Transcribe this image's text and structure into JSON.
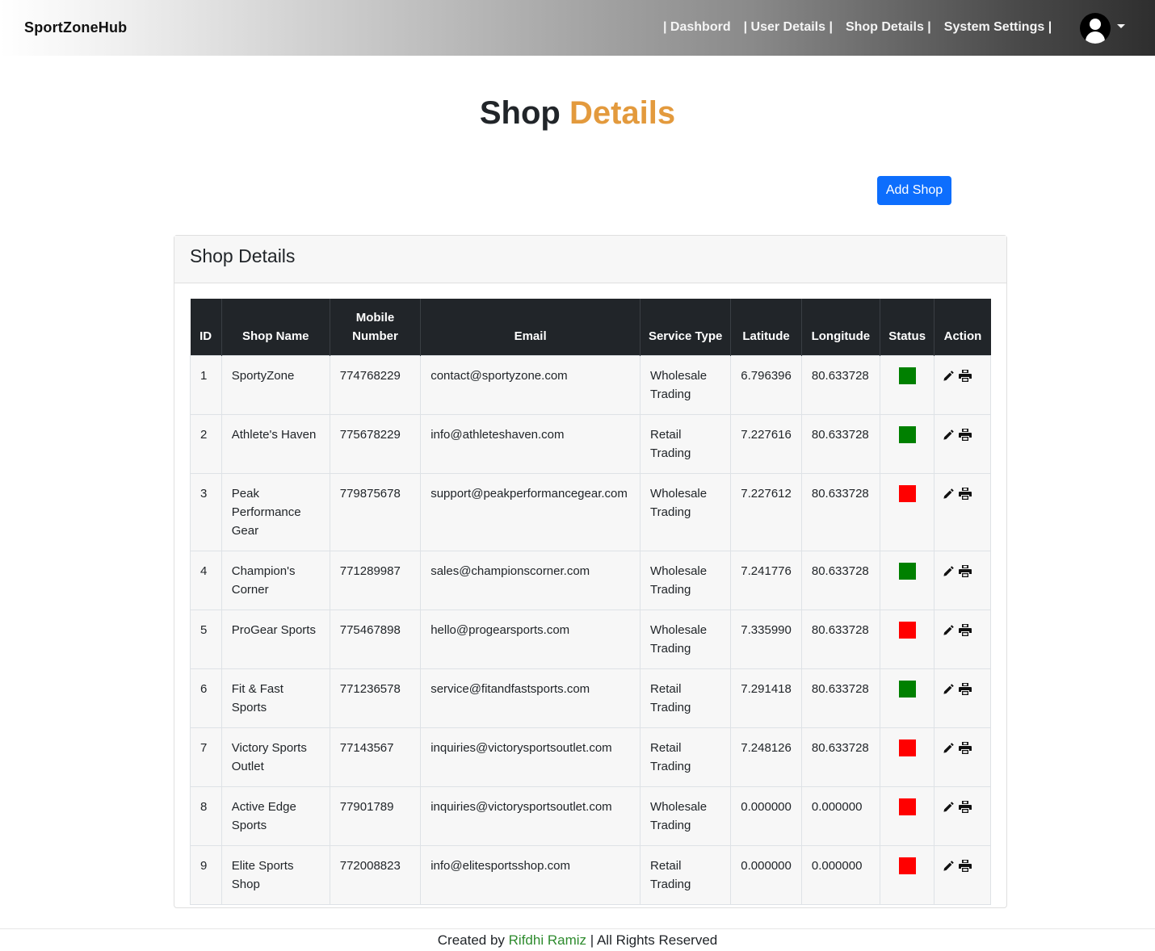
{
  "brand": "SportZoneHub",
  "nav": {
    "links": [
      "| Dashbord",
      "| User Details |",
      "Shop Details |",
      "System Settings |"
    ]
  },
  "page": {
    "title_part1": "Shop",
    "title_part2": "Details",
    "add_button": "Add Shop"
  },
  "card": {
    "header": "Shop Details"
  },
  "table": {
    "headers": [
      "ID",
      "Shop Name",
      "Mobile Number",
      "Email",
      "Service Type",
      "Latitude",
      "Longitude",
      "Status",
      "Action"
    ],
    "rows": [
      {
        "id": "1",
        "name": "SportyZone",
        "mobile": "774768229",
        "email": "contact@sportyzone.com",
        "service": "Wholesale Trading",
        "lat": "6.796396",
        "lng": "80.633728",
        "status": "active"
      },
      {
        "id": "2",
        "name": "Athlete's Haven",
        "mobile": "775678229",
        "email": "info@athleteshaven.com",
        "service": "Retail Trading",
        "lat": "7.227616",
        "lng": "80.633728",
        "status": "active"
      },
      {
        "id": "3",
        "name": "Peak Performance Gear",
        "mobile": "779875678",
        "email": "support@peakperformancegear.com",
        "service": "Wholesale Trading",
        "lat": "7.227612",
        "lng": "80.633728",
        "status": "inactive"
      },
      {
        "id": "4",
        "name": "Champion's Corner",
        "mobile": "771289987",
        "email": "sales@championscorner.com",
        "service": "Wholesale Trading",
        "lat": "7.241776",
        "lng": "80.633728",
        "status": "active"
      },
      {
        "id": "5",
        "name": "ProGear Sports",
        "mobile": "775467898",
        "email": "hello@progearsports.com",
        "service": "Wholesale Trading",
        "lat": "7.335990",
        "lng": "80.633728",
        "status": "inactive"
      },
      {
        "id": "6",
        "name": "Fit & Fast Sports",
        "mobile": "771236578",
        "email": "service@fitandfastsports.com",
        "service": "Retail Trading",
        "lat": "7.291418",
        "lng": "80.633728",
        "status": "active"
      },
      {
        "id": "7",
        "name": "Victory Sports Outlet",
        "mobile": "77143567",
        "email": "inquiries@victorysportsoutlet.com",
        "service": "Retail Trading",
        "lat": "7.248126",
        "lng": "80.633728",
        "status": "inactive"
      },
      {
        "id": "8",
        "name": "Active Edge Sports",
        "mobile": "77901789",
        "email": "inquiries@victorysportsoutlet.com",
        "service": "Wholesale Trading",
        "lat": "0.000000",
        "lng": "0.000000",
        "status": "inactive"
      },
      {
        "id": "9",
        "name": "Elite Sports Shop",
        "mobile": "772008823",
        "email": "info@elitesportsshop.com",
        "service": "Retail Trading",
        "lat": "0.000000",
        "lng": "0.000000",
        "status": "inactive"
      }
    ]
  },
  "footer": {
    "prefix": "Created by",
    "author": "Rifdhi Ramiz",
    "suffix": "| All Rights Reserved"
  },
  "colors": {
    "accent": "#e39a3d",
    "primary_button": "#0d6efd",
    "status_active": "#008000",
    "status_inactive": "#ff0000",
    "table_header": "#212529",
    "footer_author": "#2e8b2e"
  },
  "icons": {
    "edit": "pencil-icon",
    "print": "printer-icon",
    "user": "user-avatar-icon",
    "dropdown": "caret-down-icon"
  }
}
